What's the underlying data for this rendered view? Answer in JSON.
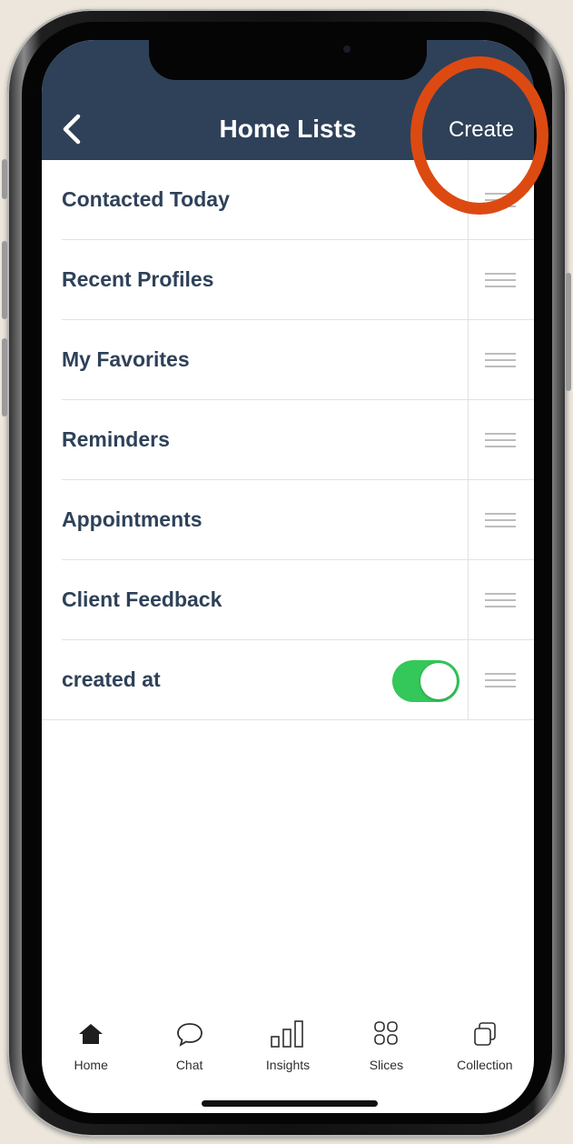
{
  "navbar": {
    "back_icon": "chevron-left-icon",
    "title": "Home Lists",
    "create_label": "Create",
    "background": "#2e4159"
  },
  "list": {
    "items": [
      {
        "label": "Contacted Today"
      },
      {
        "label": "Recent Profiles"
      },
      {
        "label": "My Favorites"
      },
      {
        "label": "Reminders"
      },
      {
        "label": "Appointments"
      },
      {
        "label": "Client Feedback"
      },
      {
        "label": "created at",
        "toggle": true,
        "toggle_on": true
      }
    ],
    "handle_icon": "drag-handle-icon",
    "toggle_color": "#34c759",
    "text_color": "#2e4159"
  },
  "tabbar": {
    "tabs": [
      {
        "label": "Home",
        "icon": "home-icon"
      },
      {
        "label": "Chat",
        "icon": "chat-bubble-icon"
      },
      {
        "label": "Insights",
        "icon": "bar-chart-icon"
      },
      {
        "label": "Slices",
        "icon": "grid-icon"
      },
      {
        "label": "Collection",
        "icon": "copy-icon"
      }
    ]
  },
  "annotation": {
    "highlight_color": "#dc4a12"
  }
}
